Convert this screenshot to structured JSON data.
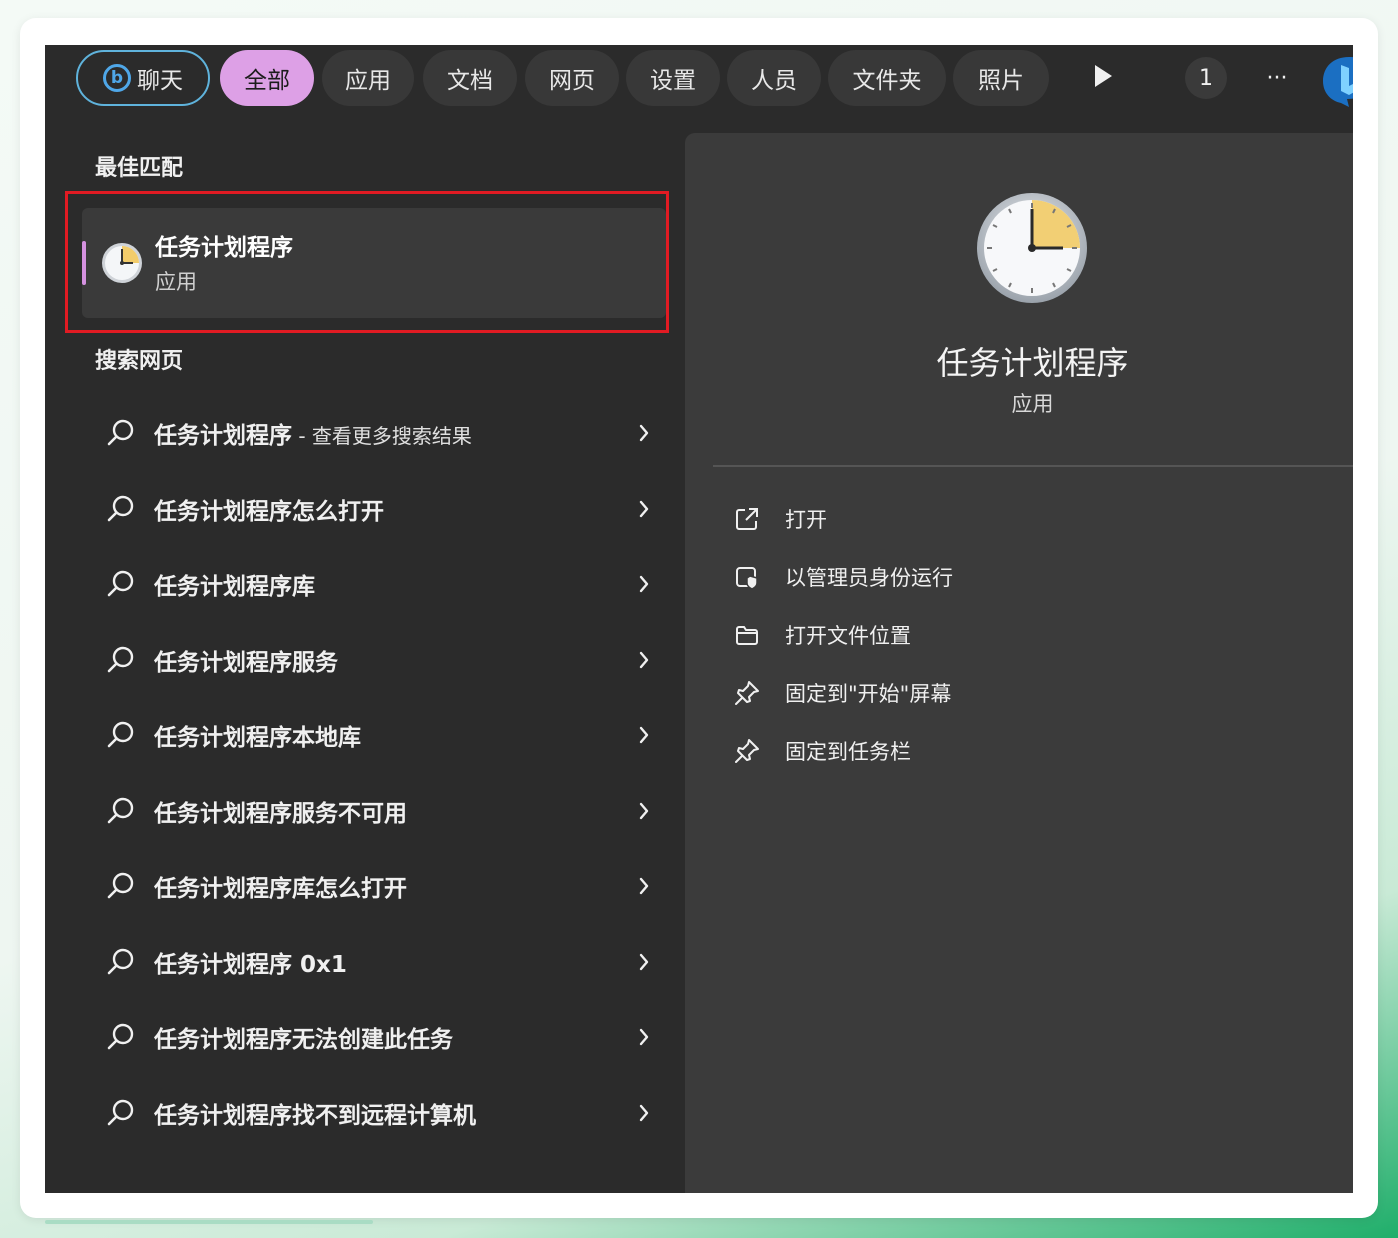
{
  "filter_bar": {
    "chat": "聊天",
    "tabs": [
      "全部",
      "应用",
      "文档",
      "网页",
      "设置",
      "人员",
      "文件夹",
      "照片"
    ],
    "active_tab": "全部",
    "count": "1",
    "more": "···"
  },
  "best_match": {
    "section_label": "最佳匹配",
    "title": "任务计划程序",
    "subtitle": "应用"
  },
  "web_search": {
    "section_label": "搜索网页",
    "items": [
      {
        "text": "任务计划程序",
        "suffix": " - 查看更多搜索结果"
      },
      {
        "text": "任务计划程序怎么打开",
        "suffix": ""
      },
      {
        "text": "任务计划程序库",
        "suffix": ""
      },
      {
        "text": "任务计划程序服务",
        "suffix": ""
      },
      {
        "text": "任务计划程序本地库",
        "suffix": ""
      },
      {
        "text": "任务计划程序服务不可用",
        "suffix": ""
      },
      {
        "text": "任务计划程序库怎么打开",
        "suffix": ""
      },
      {
        "text": "任务计划程序 0x1",
        "suffix": ""
      },
      {
        "text": "任务计划程序无法创建此任务",
        "suffix": ""
      },
      {
        "text": "任务计划程序找不到远程计算机",
        "suffix": ""
      }
    ]
  },
  "detail": {
    "title": "任务计划程序",
    "subtitle": "应用",
    "actions": [
      {
        "label": "打开",
        "icon": "open-external-icon"
      },
      {
        "label": "以管理员身份运行",
        "icon": "shield-admin-icon"
      },
      {
        "label": "打开文件位置",
        "icon": "folder-icon"
      },
      {
        "label": "固定到\"开始\"屏幕",
        "icon": "pin-icon"
      },
      {
        "label": "固定到任务栏",
        "icon": "pin-icon"
      }
    ]
  },
  "colors": {
    "accent_pink": "#dda0e6",
    "highlight_box": "#e11b23",
    "bing_blue": "#4fa7e8"
  }
}
